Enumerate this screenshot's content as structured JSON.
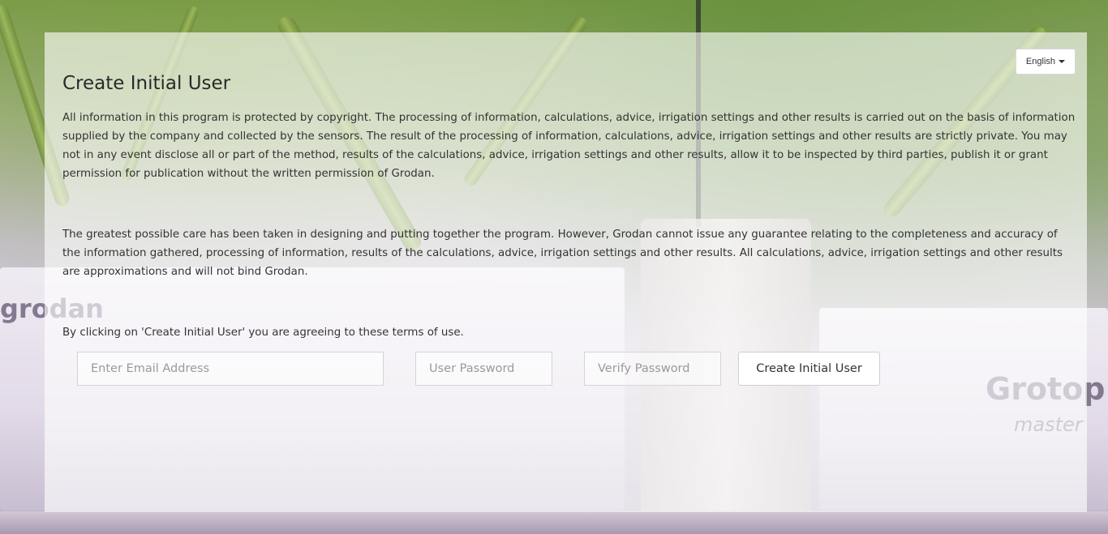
{
  "language": {
    "selected": "English"
  },
  "page": {
    "title": "Create Initial User",
    "paragraphs": [
      "All information in this program is protected by copyright. The processing of information, calculations, advice, irrigation settings and other results is carried out on the basis of information supplied by the company and collected by the sensors. The result of the processing of information, calculations, advice, irrigation settings and other results are strictly private. You may not in any event disclose all or part of the method, results of the calculations, advice, irrigation settings and other results, allow it to be inspected by third parties, publish it or grant permission for publication without the written permission of Grodan.",
      "The greatest possible care has been taken in designing and putting together the program. However, Grodan cannot issue any guarantee relating to the completeness and accuracy of the information gathered, processing of information, results of the calculations, advice, irrigation settings and other results. All calculations, advice, irrigation settings and other results are approximations and will not bind Grodan.",
      "By clicking on 'Create Initial User' you are agreeing to these terms of use."
    ]
  },
  "form": {
    "email_placeholder": "Enter Email Address",
    "email_value": "",
    "password_placeholder": "User Password",
    "password_value": "",
    "verify_placeholder": "Verify Password",
    "verify_value": "",
    "submit_label": "Create Initial User"
  },
  "background": {
    "brand_texts": [
      "grodan",
      "Grotop",
      "master",
      "grodan"
    ]
  },
  "colors": {
    "panel": "#ffffff",
    "text": "#333333",
    "border": "#d4d4d4"
  },
  "icons": {
    "language_dropdown": "caret-down-icon"
  }
}
